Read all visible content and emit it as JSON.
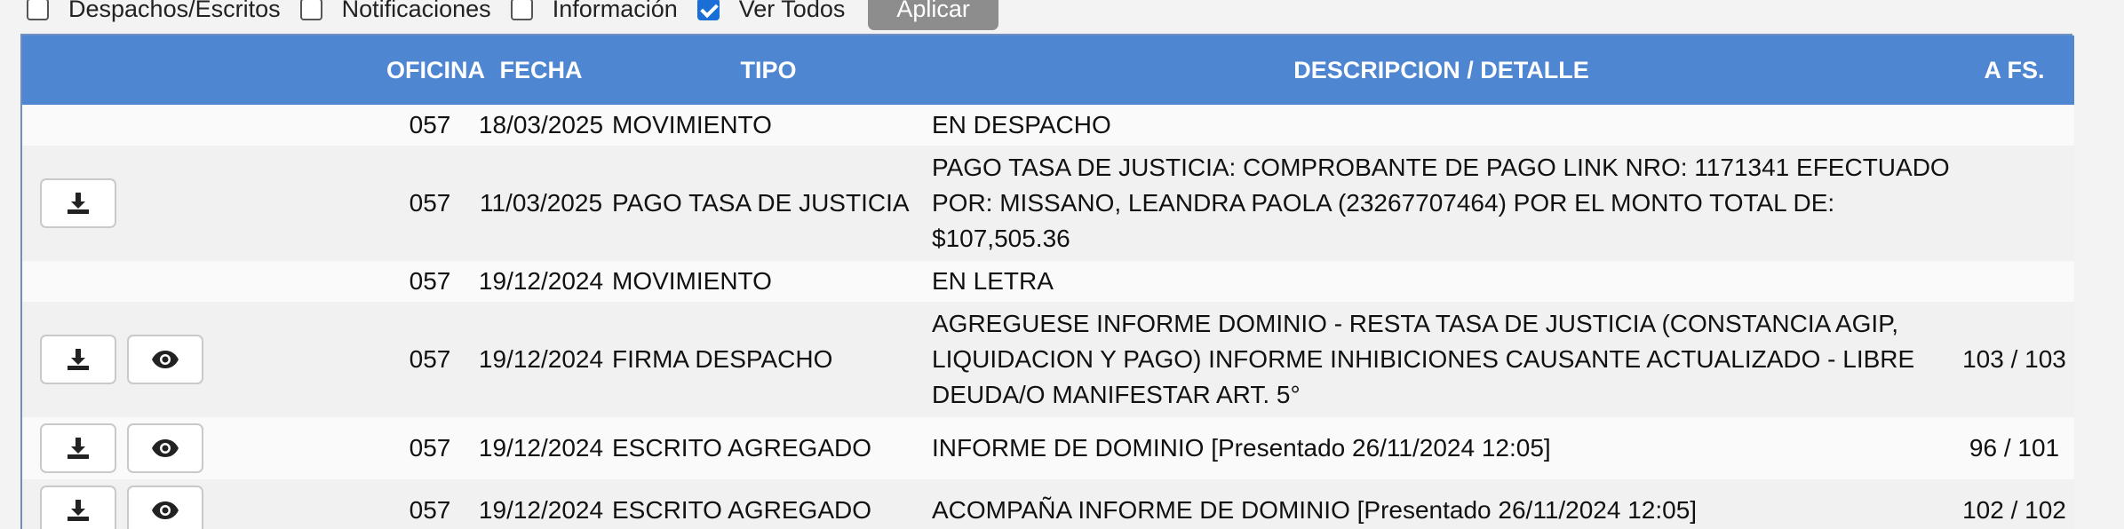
{
  "filters": {
    "items": [
      {
        "label": "Despachos/Escritos",
        "checked": false
      },
      {
        "label": "Notificaciones",
        "checked": false
      },
      {
        "label": "Información",
        "checked": false
      },
      {
        "label": "Ver Todos",
        "checked": true
      }
    ],
    "apply_label": "Aplicar"
  },
  "table": {
    "headers": {
      "oficina": "OFICINA",
      "fecha": "FECHA",
      "tipo": "TIPO",
      "descripcion": "DESCRIPCION / DETALLE",
      "afs": "A FS."
    },
    "rows": [
      {
        "download": false,
        "view": false,
        "oficina": "057",
        "fecha": "18/03/2025",
        "tipo": "MOVIMIENTO",
        "descripcion": "EN DESPACHO",
        "afs": ""
      },
      {
        "download": true,
        "view": false,
        "oficina": "057",
        "fecha": "11/03/2025",
        "tipo": "PAGO TASA DE JUSTICIA",
        "descripcion": "PAGO TASA DE JUSTICIA: COMPROBANTE DE PAGO LINK NRO: 1171341 EFECTUADO POR: MISSANO, LEANDRA PAOLA (23267707464) POR EL MONTO TOTAL DE: $107,505.36",
        "afs": ""
      },
      {
        "download": false,
        "view": false,
        "oficina": "057",
        "fecha": "19/12/2024",
        "tipo": "MOVIMIENTO",
        "descripcion": "EN LETRA",
        "afs": ""
      },
      {
        "download": true,
        "view": true,
        "oficina": "057",
        "fecha": "19/12/2024",
        "tipo": "FIRMA DESPACHO",
        "descripcion": "AGREGUESE INFORME DOMINIO - RESTA TASA DE JUSTICIA (CONSTANCIA AGIP, LIQUIDACION Y PAGO) INFORME INHIBICIONES CAUSANTE ACTUALIZADO - LIBRE DEUDA/O MANIFESTAR ART. 5°",
        "afs": "103 / 103"
      },
      {
        "download": true,
        "view": true,
        "oficina": "057",
        "fecha": "19/12/2024",
        "tipo": "ESCRITO AGREGADO",
        "descripcion": "INFORME DE DOMINIO [Presentado 26/11/2024 12:05]",
        "afs": "96 / 101"
      },
      {
        "download": true,
        "view": true,
        "oficina": "057",
        "fecha": "19/12/2024",
        "tipo": "ESCRITO AGREGADO",
        "descripcion": "ACOMPAÑA INFORME DE DOMINIO [Presentado 26/11/2024 12:05]",
        "afs": "102 / 102"
      }
    ]
  },
  "icons": {
    "download": "download-icon",
    "view": "eye-icon"
  },
  "colors": {
    "header_bg": "#4f86d1",
    "checkbox_checked": "#1a6fd6",
    "apply_button_bg": "#8d8d8d"
  }
}
